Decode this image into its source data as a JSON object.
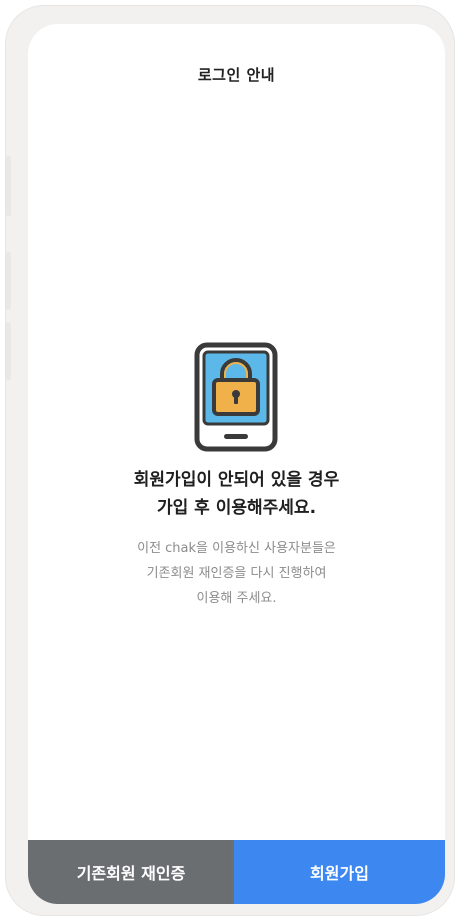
{
  "header": {
    "title": "로그인 안내"
  },
  "main": {
    "icon": "locked-phone-icon",
    "headline_line1": "회원가입이 안되어 있을 경우",
    "headline_line2": "가입 후 이용해주세요.",
    "desc_line1": "이전 chak을 이용하신 사용자분들은",
    "desc_line2": "기존회원 재인증을 다시 진행하여",
    "desc_line3": "이용해 주세요."
  },
  "footer": {
    "existing_member_label": "기존회원 재인증",
    "signup_label": "회원가입"
  },
  "colors": {
    "existing_button": "#6b6e71",
    "signup_button": "#3c87f0",
    "lock_body": "#f0b04a",
    "phone_screen": "#5bb8e8",
    "phone_outline": "#3a3a3a"
  }
}
